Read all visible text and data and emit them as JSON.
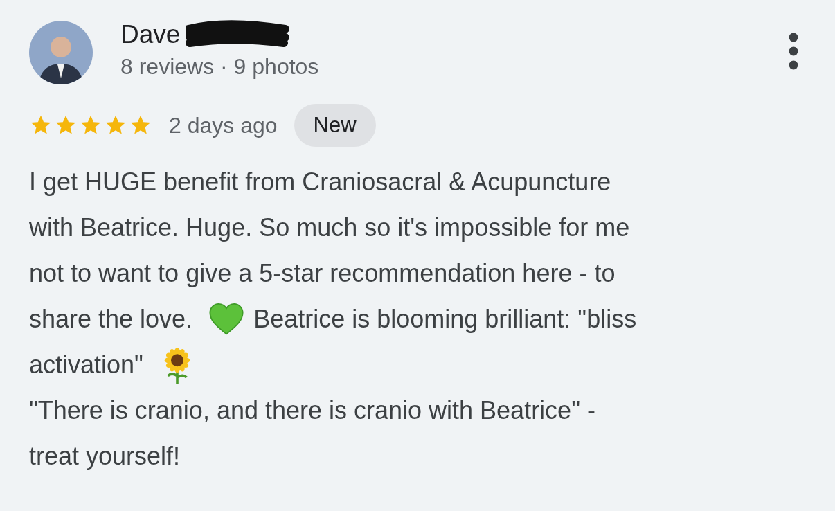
{
  "review": {
    "reviewer": {
      "name": "Dave",
      "name_redacted": true,
      "stats": "8 reviews · 9 photos"
    },
    "rating": {
      "stars": 5
    },
    "time": "2 days ago",
    "badge": "New",
    "lines": [
      [
        {
          "kind": "text",
          "text": "I get HUGE benefit from Craniosacral & Acupuncture"
        }
      ],
      [
        {
          "kind": "text",
          "text": "with Beatrice. Huge. So much so it's impossible for me"
        }
      ],
      [
        {
          "kind": "text",
          "text": "not to want to give a 5-star recommendation here - to"
        }
      ],
      [
        {
          "kind": "text",
          "text": "share the love."
        },
        {
          "kind": "heart-emoji"
        },
        {
          "kind": "text",
          "text": "Beatrice is blooming brilliant: \"bliss"
        }
      ],
      [
        {
          "kind": "text",
          "text": "activation\""
        },
        {
          "kind": "sunflower-emoji"
        }
      ],
      [
        {
          "kind": "text",
          "text": "\"There is cranio, and there is cranio with Beatrice\" -"
        }
      ],
      [
        {
          "kind": "text",
          "text": "treat yourself!"
        }
      ]
    ]
  }
}
